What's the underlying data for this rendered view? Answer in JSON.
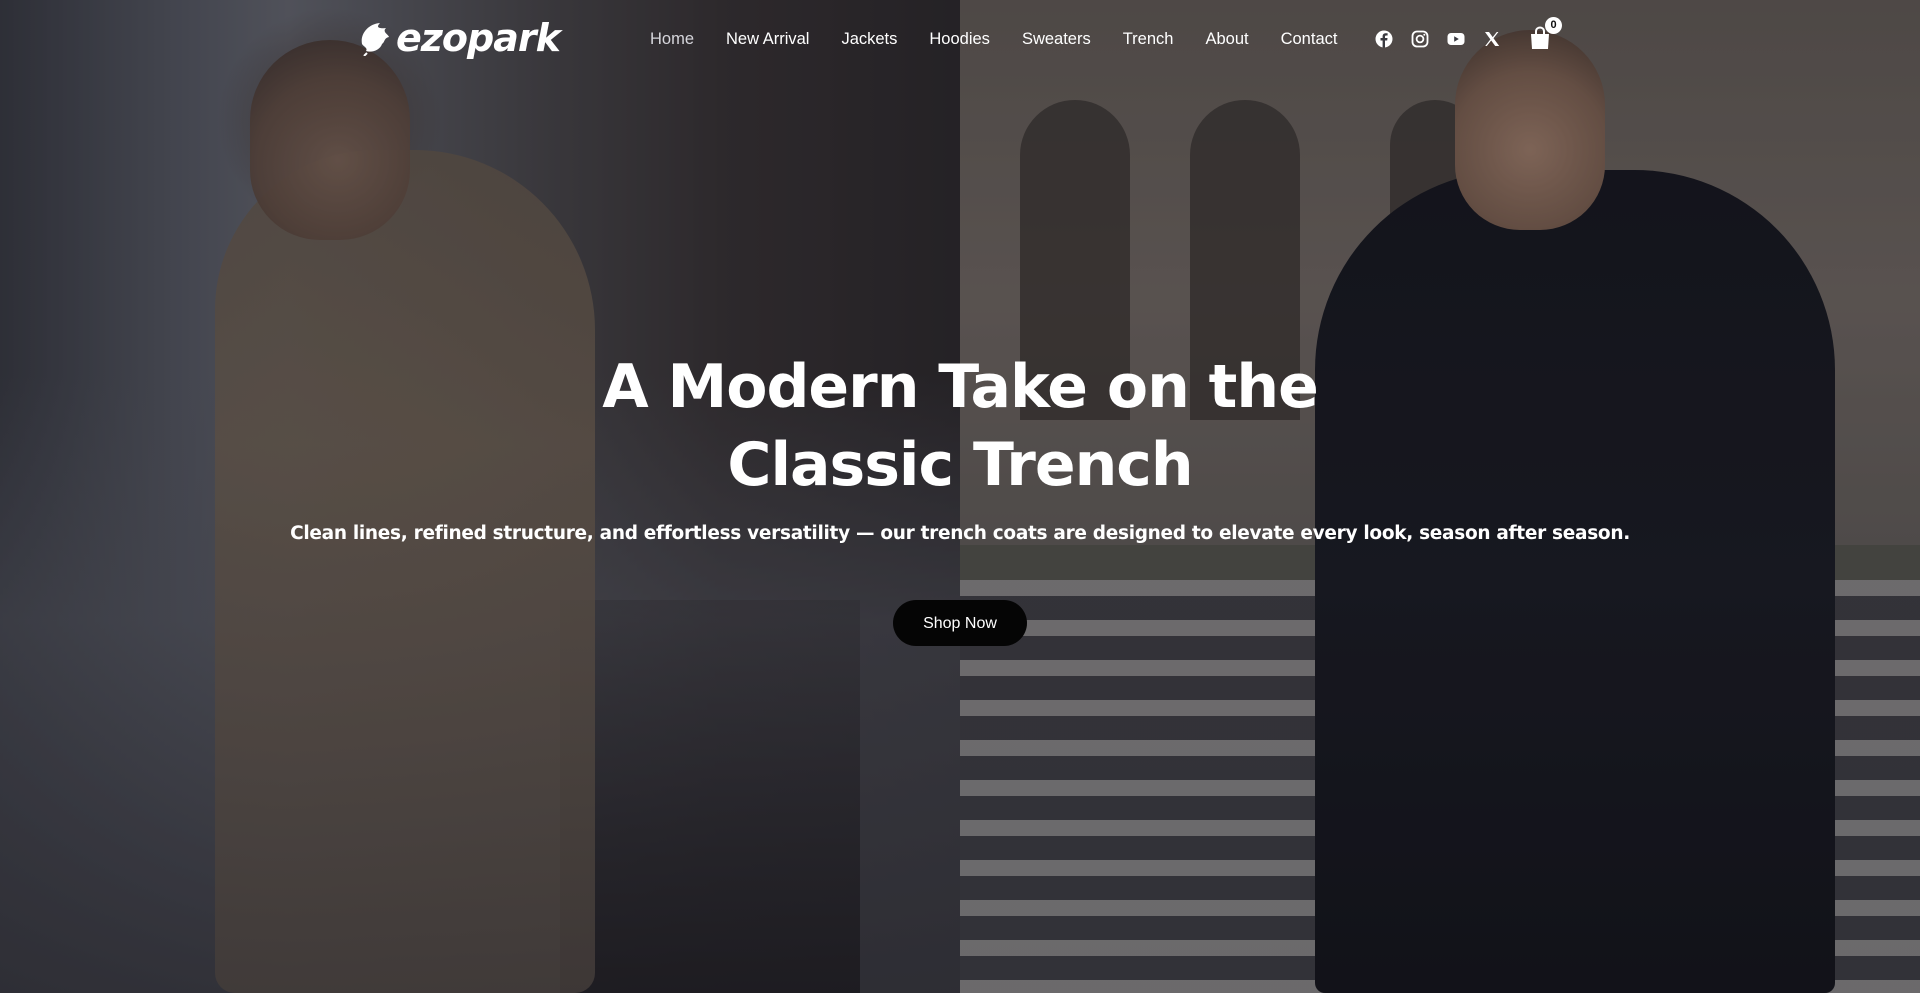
{
  "brand": {
    "name": "ezopark",
    "logo_icon": "leaf-bird-icon"
  },
  "nav": {
    "items": [
      {
        "label": "Home",
        "active": true
      },
      {
        "label": "New Arrival",
        "active": false
      },
      {
        "label": "Jackets",
        "active": false
      },
      {
        "label": "Hoodies",
        "active": false
      },
      {
        "label": "Sweaters",
        "active": false
      },
      {
        "label": "Trench",
        "active": false
      },
      {
        "label": "About",
        "active": false
      },
      {
        "label": "Contact",
        "active": false
      }
    ]
  },
  "social": [
    "facebook-icon",
    "instagram-icon",
    "youtube-icon",
    "x-icon"
  ],
  "cart": {
    "icon": "shopping-bag-icon",
    "count": "0"
  },
  "hero": {
    "title": "A Modern Take on the Classic Trench",
    "subtitle": "Clean lines, refined structure, and effortless versatility — our trench coats are designed to elevate every look, season after season.",
    "cta_label": "Shop Now"
  },
  "colors": {
    "text": "#ffffff",
    "button_bg": "#050505",
    "active_nav": "#d6d6dc"
  }
}
